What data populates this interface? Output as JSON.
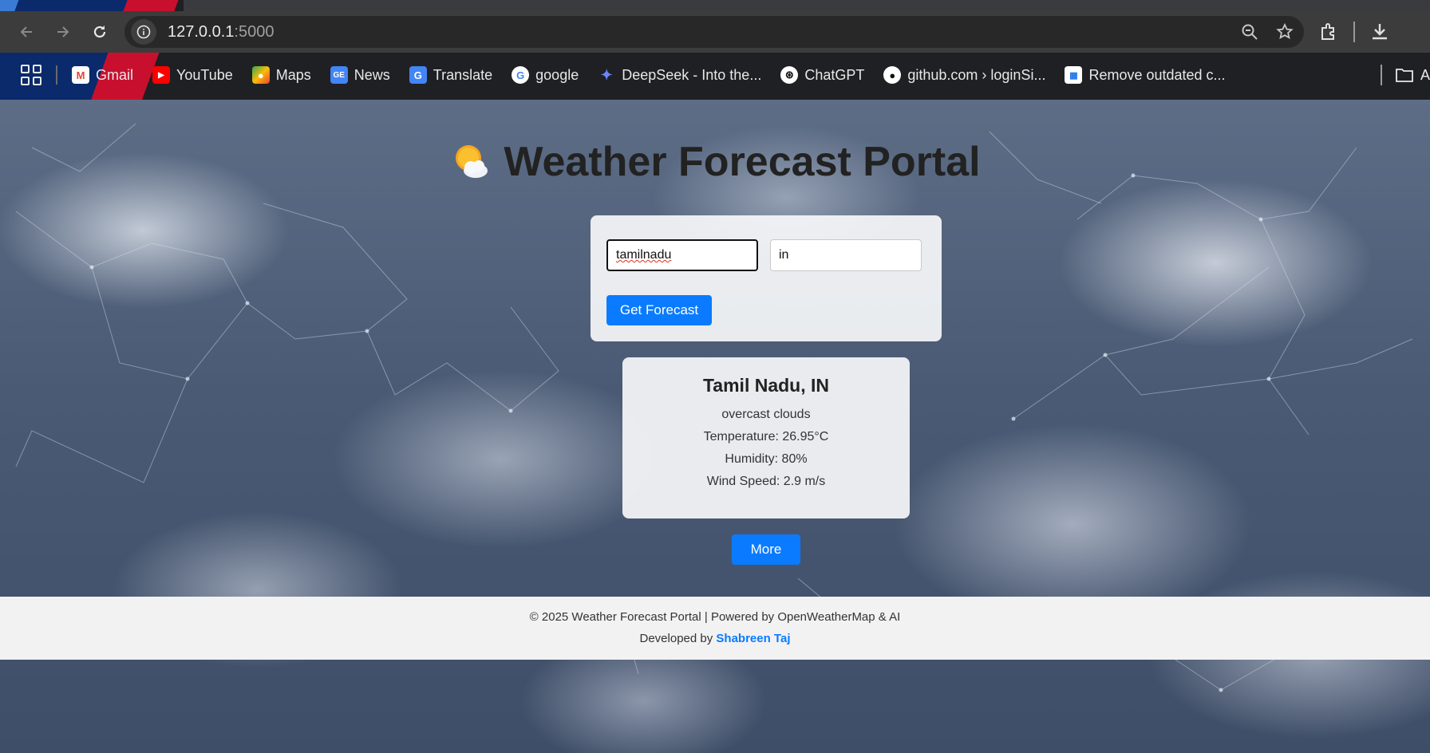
{
  "browser": {
    "url_host": "127.0.0.1",
    "url_port": ":5000",
    "bookmarks": [
      {
        "label": "Gmail",
        "icon": "gmail-icon",
        "color": "#ea4335"
      },
      {
        "label": "YouTube",
        "icon": "youtube-icon",
        "color": "#ff0000"
      },
      {
        "label": "Maps",
        "icon": "maps-icon",
        "color": "#34a853"
      },
      {
        "label": "News",
        "icon": "news-icon",
        "color": "#4285f4"
      },
      {
        "label": "Translate",
        "icon": "translate-icon",
        "color": "#4285f4"
      },
      {
        "label": "google",
        "icon": "google-icon",
        "color": "#ffffff"
      },
      {
        "label": "DeepSeek - Into the...",
        "icon": "deepseek-icon",
        "color": "#4d6bfe"
      },
      {
        "label": "ChatGPT",
        "icon": "chatgpt-icon",
        "color": "#ffffff"
      },
      {
        "label": "github.com › loginSi...",
        "icon": "github-icon",
        "color": "#ffffff"
      },
      {
        "label": "Remove outdated c...",
        "icon": "calendar-icon",
        "color": "#1a73e8"
      }
    ],
    "bookmark_folder_label": "A"
  },
  "page": {
    "title": "Weather Forecast Portal",
    "city_input_value": "tamilnadu",
    "country_input_value": "in",
    "forecast_button": "Get Forecast",
    "result": {
      "location": "Tamil Nadu, IN",
      "description": "overcast clouds",
      "temperature": "Temperature: 26.95°C",
      "humidity": "Humidity: 80%",
      "wind": "Wind Speed: 2.9 m/s"
    },
    "more_button": "More"
  },
  "footer": {
    "line1": "© 2025 Weather Forecast Portal | Powered by OpenWeatherMap & AI",
    "developed_by": "Developed by",
    "developer": "Shabreen Taj"
  },
  "colors": {
    "accent": "#0a7bff",
    "title": "#222222"
  }
}
